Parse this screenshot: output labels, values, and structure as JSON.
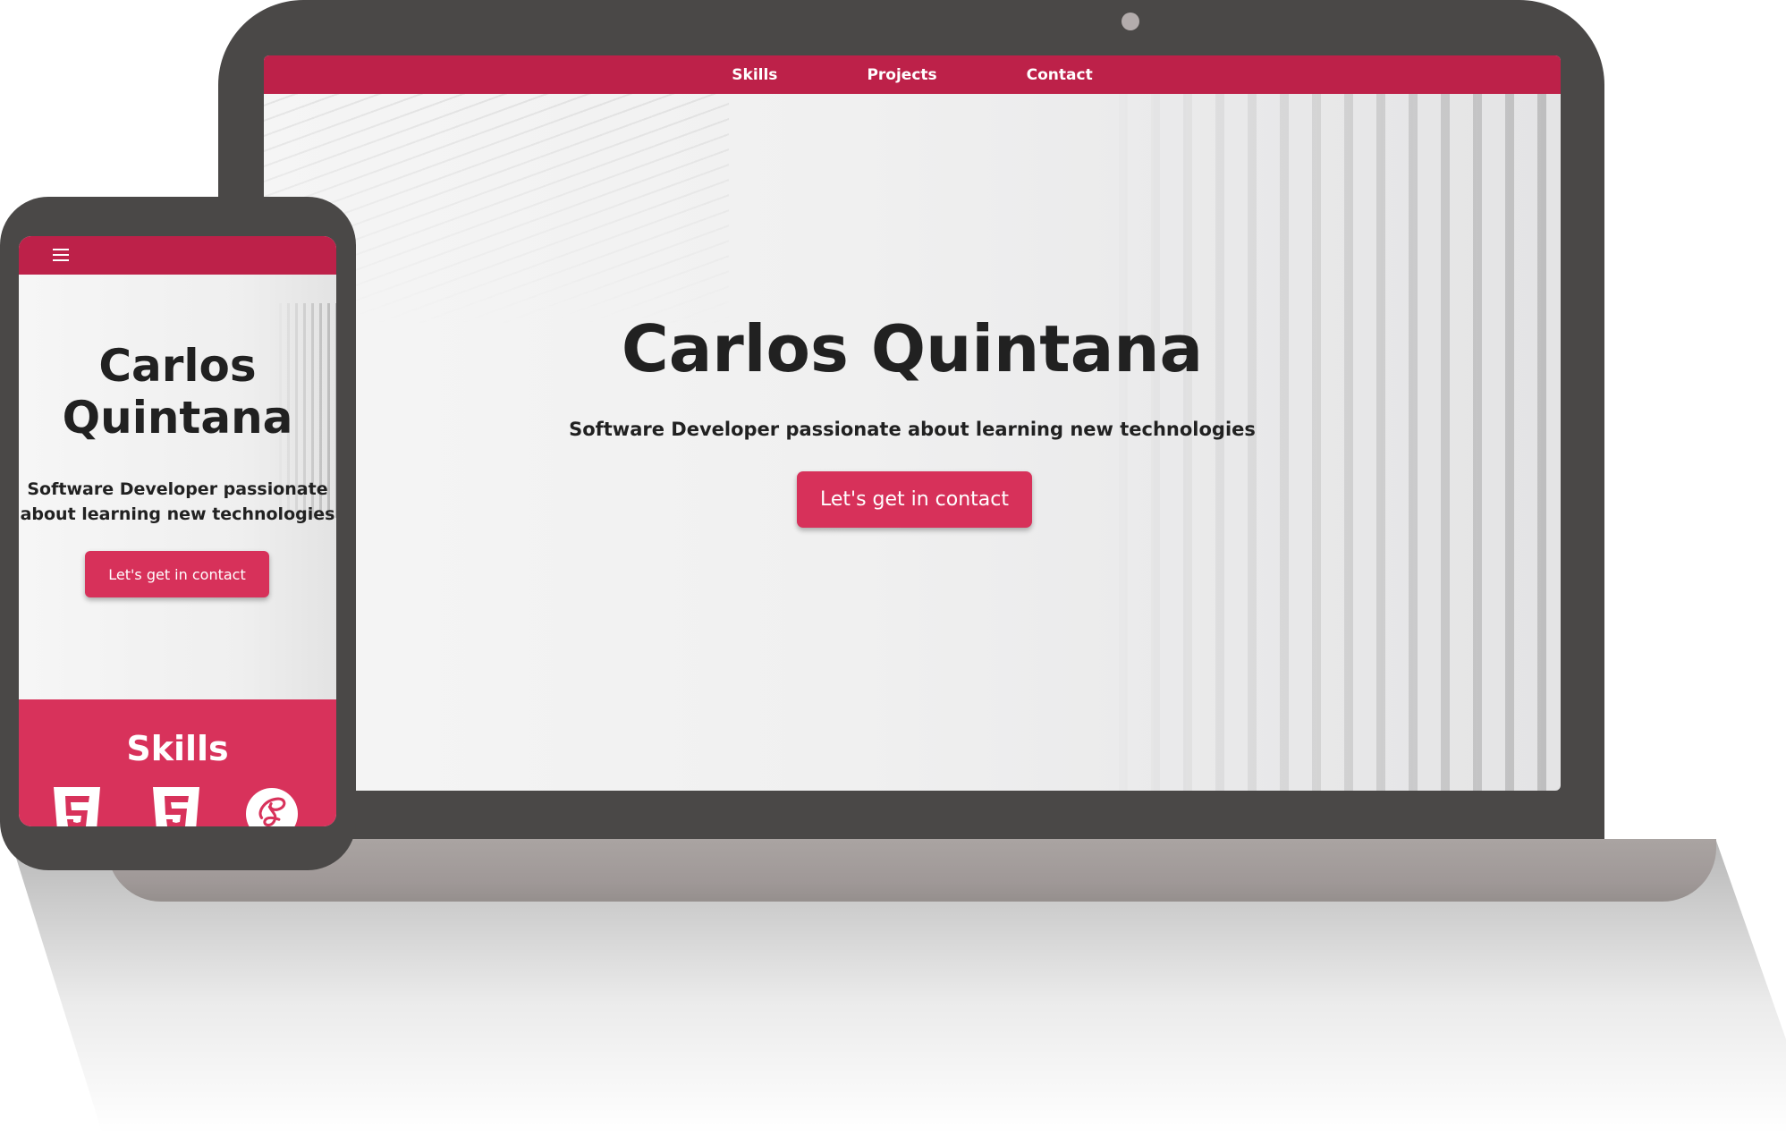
{
  "laptop": {
    "nav": {
      "items": [
        {
          "label": "Skills"
        },
        {
          "label": "Projects"
        },
        {
          "label": "Contact"
        }
      ]
    },
    "hero": {
      "title": "Carlos Quintana",
      "subtitle": "Software Developer passionate about learning new technologies",
      "cta_label": "Let's get in contact"
    }
  },
  "phone": {
    "nav": {
      "menu_icon": "hamburger-menu-icon"
    },
    "hero": {
      "title_line1": "Carlos",
      "title_line2": "Quintana",
      "subtitle_line1": "Software Developer passionate",
      "subtitle_line2": "about learning new technologies",
      "cta_label": "Let's get in contact"
    },
    "skills": {
      "heading": "Skills",
      "icons": [
        "html5-icon",
        "css3-icon",
        "sass-icon"
      ]
    }
  },
  "colors": {
    "nav_bar": "#bd2149",
    "accent": "#d7315a",
    "device_frame": "#4a4847",
    "text": "#212121"
  }
}
